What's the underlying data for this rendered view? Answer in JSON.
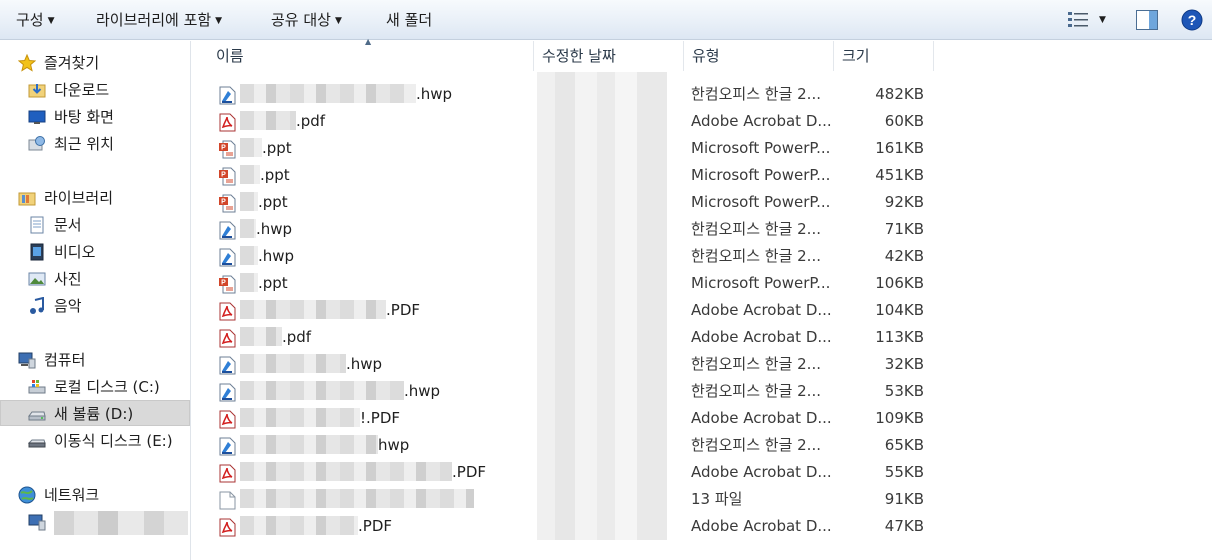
{
  "toolbar": {
    "organize": "구성",
    "include_in_library": "라이브러리에 포함",
    "share_with": "공유 대상",
    "new_folder": "새 폴더"
  },
  "nav": {
    "favorites": "즐겨찾기",
    "downloads": "다운로드",
    "desktop": "바탕 화면",
    "recent_places": "최근 위치",
    "libraries": "라이브러리",
    "documents": "문서",
    "videos": "비디오",
    "pictures": "사진",
    "music": "음악",
    "computer": "컴퓨터",
    "local_disk": "로컬 디스크 (C:)",
    "new_volume": "새 볼륨 (D:)",
    "removable_disk": "이동식 디스크 (E:)",
    "network": "네트워크"
  },
  "columns": {
    "name": "이름",
    "date_modified": "수정한 날짜",
    "type": "유형",
    "size": "크기"
  },
  "files": [
    {
      "ext": ".hwp",
      "icon": "hwp-icon",
      "type": "한컴오피스 한글 2...",
      "size": "482KB"
    },
    {
      "ext": ".pdf",
      "icon": "pdf-icon",
      "type": "Adobe Acrobat D...",
      "size": "60KB"
    },
    {
      "ext": ".ppt",
      "icon": "ppt-icon",
      "type": "Microsoft PowerP...",
      "size": "161KB"
    },
    {
      "ext": ".ppt",
      "icon": "ppt-icon",
      "type": "Microsoft PowerP...",
      "size": "451KB"
    },
    {
      "ext": ".ppt",
      "icon": "ppt-icon",
      "type": "Microsoft PowerP...",
      "size": "92KB"
    },
    {
      "ext": ".hwp",
      "icon": "hwp-icon",
      "type": "한컴오피스 한글 2...",
      "size": "71KB"
    },
    {
      "ext": ".hwp",
      "icon": "hwp-icon",
      "type": "한컴오피스 한글 2...",
      "size": "42KB"
    },
    {
      "ext": ".ppt",
      "icon": "ppt-icon",
      "type": "Microsoft PowerP...",
      "size": "106KB"
    },
    {
      "ext": ".PDF",
      "icon": "pdf-icon",
      "type": "Adobe Acrobat D...",
      "size": "104KB"
    },
    {
      "ext": ".pdf",
      "icon": "pdf-icon",
      "type": "Adobe Acrobat D...",
      "size": "113KB"
    },
    {
      "ext": ".hwp",
      "icon": "hwp-icon",
      "type": "한컴오피스 한글 2...",
      "size": "32KB"
    },
    {
      "ext": ".hwp",
      "icon": "hwp-icon",
      "type": "한컴오피스 한글 2...",
      "size": "53KB"
    },
    {
      "ext": "!.PDF",
      "icon": "pdf-icon",
      "type": "Adobe Acrobat D...",
      "size": "109KB"
    },
    {
      "ext": "hwp",
      "icon": "hwp-icon",
      "type": "한컴오피스 한글 2...",
      "size": "65KB"
    },
    {
      "ext": ".PDF",
      "icon": "pdf-icon",
      "type": "Adobe Acrobat D...",
      "size": "55KB"
    },
    {
      "ext": "",
      "icon": "blank-file-icon",
      "type": "13 파일",
      "size": "91KB"
    },
    {
      "ext": ".PDF",
      "icon": "pdf-icon",
      "type": "Adobe Acrobat D...",
      "size": "47KB"
    }
  ],
  "colors": {
    "toolbar_bg": "#e9f0f8",
    "selected_bg": "#d9d9d9",
    "header_text": "#2b3a4a"
  }
}
